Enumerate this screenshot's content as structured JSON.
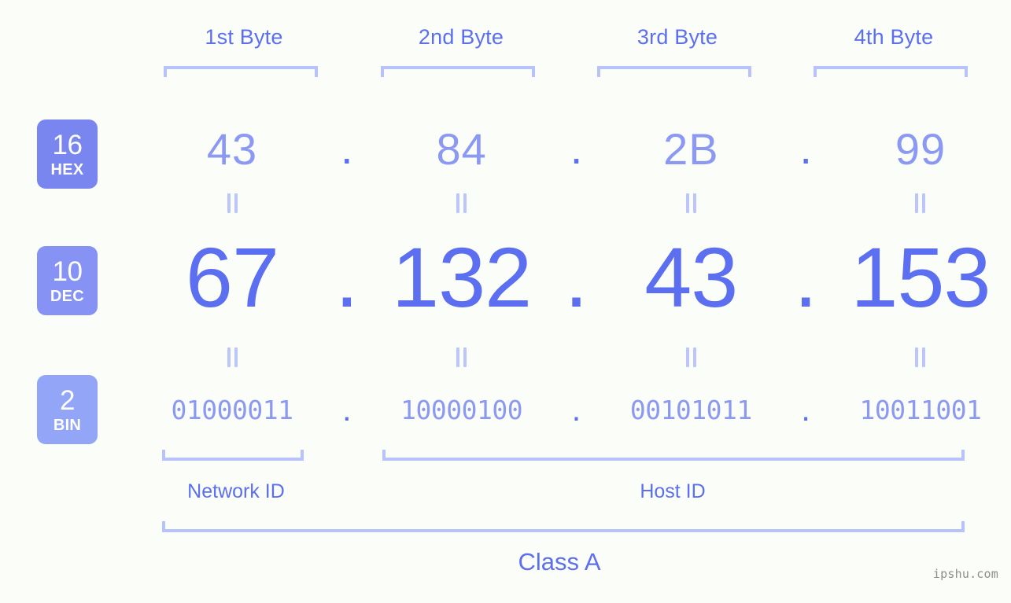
{
  "background_color": "#fbfdf9",
  "accent_color": "#5b6ff0",
  "light_accent_color": "#8b99f2",
  "bracket_color": "#b8c2fb",
  "byte_headers": [
    {
      "label": "1st Byte"
    },
    {
      "label": "2nd Byte"
    },
    {
      "label": "3rd Byte"
    },
    {
      "label": "4th Byte"
    }
  ],
  "bases": [
    {
      "number": "16",
      "name": "HEX",
      "color": "#7986f0"
    },
    {
      "number": "10",
      "name": "DEC",
      "color": "#8693f4"
    },
    {
      "number": "2",
      "name": "BIN",
      "color": "#93a5f7"
    }
  ],
  "separator": ".",
  "equals_symbol": "=",
  "rows": {
    "hex": {
      "values": [
        "43",
        "84",
        "2B",
        "99"
      ]
    },
    "dec": {
      "values": [
        "67",
        "132",
        "43",
        "153"
      ]
    },
    "bin": {
      "values": [
        "01000011",
        "10000100",
        "00101011",
        "10011001"
      ]
    }
  },
  "sections": {
    "network_id": "Network ID",
    "host_id": "Host ID",
    "class": "Class A"
  },
  "watermark": "ipshu.com"
}
